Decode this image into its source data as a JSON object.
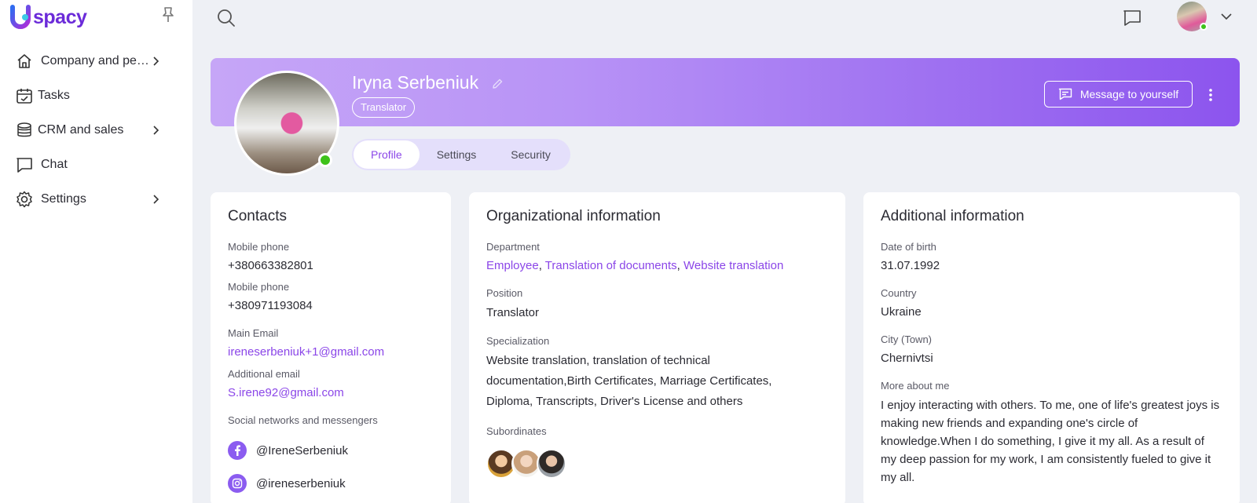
{
  "brand": {
    "logo_text": "spacy"
  },
  "sidebar": {
    "items": [
      {
        "label": "Company and people",
        "icon": "home-icon",
        "has_children": true
      },
      {
        "label": "Tasks",
        "icon": "calendar-icon",
        "has_children": false
      },
      {
        "label": "CRM and sales",
        "icon": "database-icon",
        "has_children": true
      },
      {
        "label": "Chat",
        "icon": "chat-icon",
        "has_children": false
      },
      {
        "label": "Settings",
        "icon": "gear-icon",
        "has_children": true
      }
    ]
  },
  "header": {
    "name": "Iryna Serbeniuk",
    "role_badge": "Translator",
    "message_button": "Message to yourself",
    "status": "online"
  },
  "tabs": [
    {
      "label": "Profile",
      "active": true
    },
    {
      "label": "Settings",
      "active": false
    },
    {
      "label": "Security",
      "active": false
    }
  ],
  "contacts": {
    "title": "Contacts",
    "mobile_label_1": "Mobile phone",
    "mobile_1": "+380663382801",
    "mobile_label_2": "Mobile phone",
    "mobile_2": "+380971193084",
    "main_email_label": "Main Email",
    "main_email": "ireneserbeniuk+1@gmail.com",
    "additional_email_label": "Additional email",
    "additional_email": "S.irene92@gmail.com",
    "social_label": "Social networks and messengers",
    "facebook": "@IreneSerbeniuk",
    "instagram": "@ireneserbeniuk"
  },
  "org": {
    "title": "Organizational information",
    "department_label": "Department",
    "departments": [
      "Employee",
      "Translation of documents",
      "Website translation"
    ],
    "separator": ", ",
    "position_label": "Position",
    "position": "Translator",
    "specialization_label": "Specialization",
    "specialization": "Website translation, translation of technical documentation,Birth Certificates, Marriage Certificates, Diploma, Transcripts, Driver's License and others",
    "subordinates_label": "Subordinates"
  },
  "additional": {
    "title": "Additional information",
    "dob_label": "Date of birth",
    "dob": "31.07.1992",
    "country_label": "Country",
    "country": "Ukraine",
    "city_label": "City (Town)",
    "city": "Chernivtsi",
    "about_label": "More about me",
    "about": "I enjoy interacting with others. To me, one of life's greatest joys is making new friends and expanding one's circle of knowledge.When I do something, I give it my all. As a result of my deep passion for my work, I am consistently fueled to give it my all."
  },
  "colors": {
    "accent": "#8b46e8",
    "online": "#3ec21a",
    "banner_start": "#c6a6f7",
    "banner_end": "#8c54ee"
  }
}
